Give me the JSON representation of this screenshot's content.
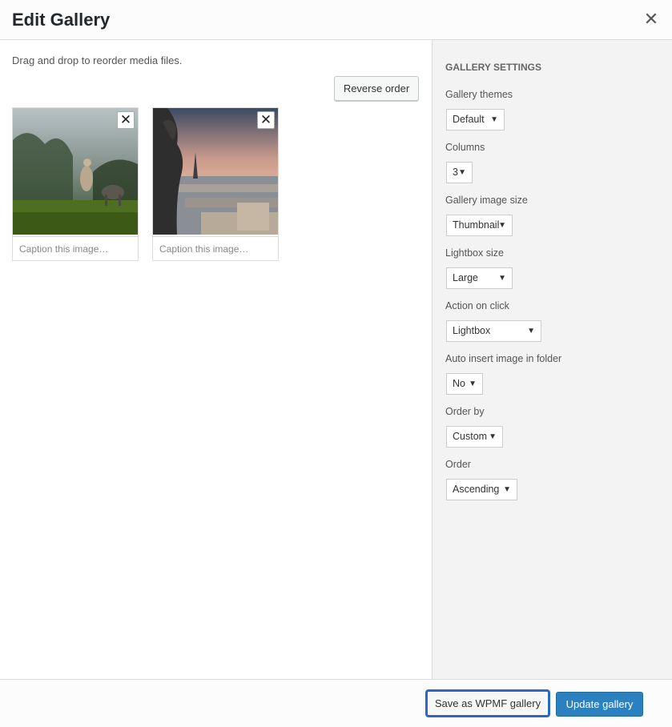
{
  "header": {
    "title": "Edit Gallery",
    "close_icon": "close-icon"
  },
  "content": {
    "hint": "Drag and drop to reorder media files.",
    "reverse_label": "Reverse order",
    "images": [
      {
        "caption_placeholder": "Caption this image…",
        "remove_icon": "close-icon"
      },
      {
        "caption_placeholder": "Caption this image…",
        "remove_icon": "close-icon"
      }
    ]
  },
  "settings": {
    "heading": "Gallery Settings",
    "fields": [
      {
        "label": "Gallery themes",
        "value": "Default"
      },
      {
        "label": "Columns",
        "value": "3"
      },
      {
        "label": "Gallery image size",
        "value": "Thumbnail"
      },
      {
        "label": "Lightbox size",
        "value": "Large"
      },
      {
        "label": "Action on click",
        "value": "Lightbox"
      },
      {
        "label": "Auto insert image in folder",
        "value": "No"
      },
      {
        "label": "Order by",
        "value": "Custom"
      },
      {
        "label": "Order",
        "value": "Ascending"
      }
    ]
  },
  "footer": {
    "save_wpmf_label": "Save as WPMF gallery",
    "update_label": "Update gallery"
  },
  "colors": {
    "primary": "#2b81c0",
    "focus": "#2a67c9"
  }
}
